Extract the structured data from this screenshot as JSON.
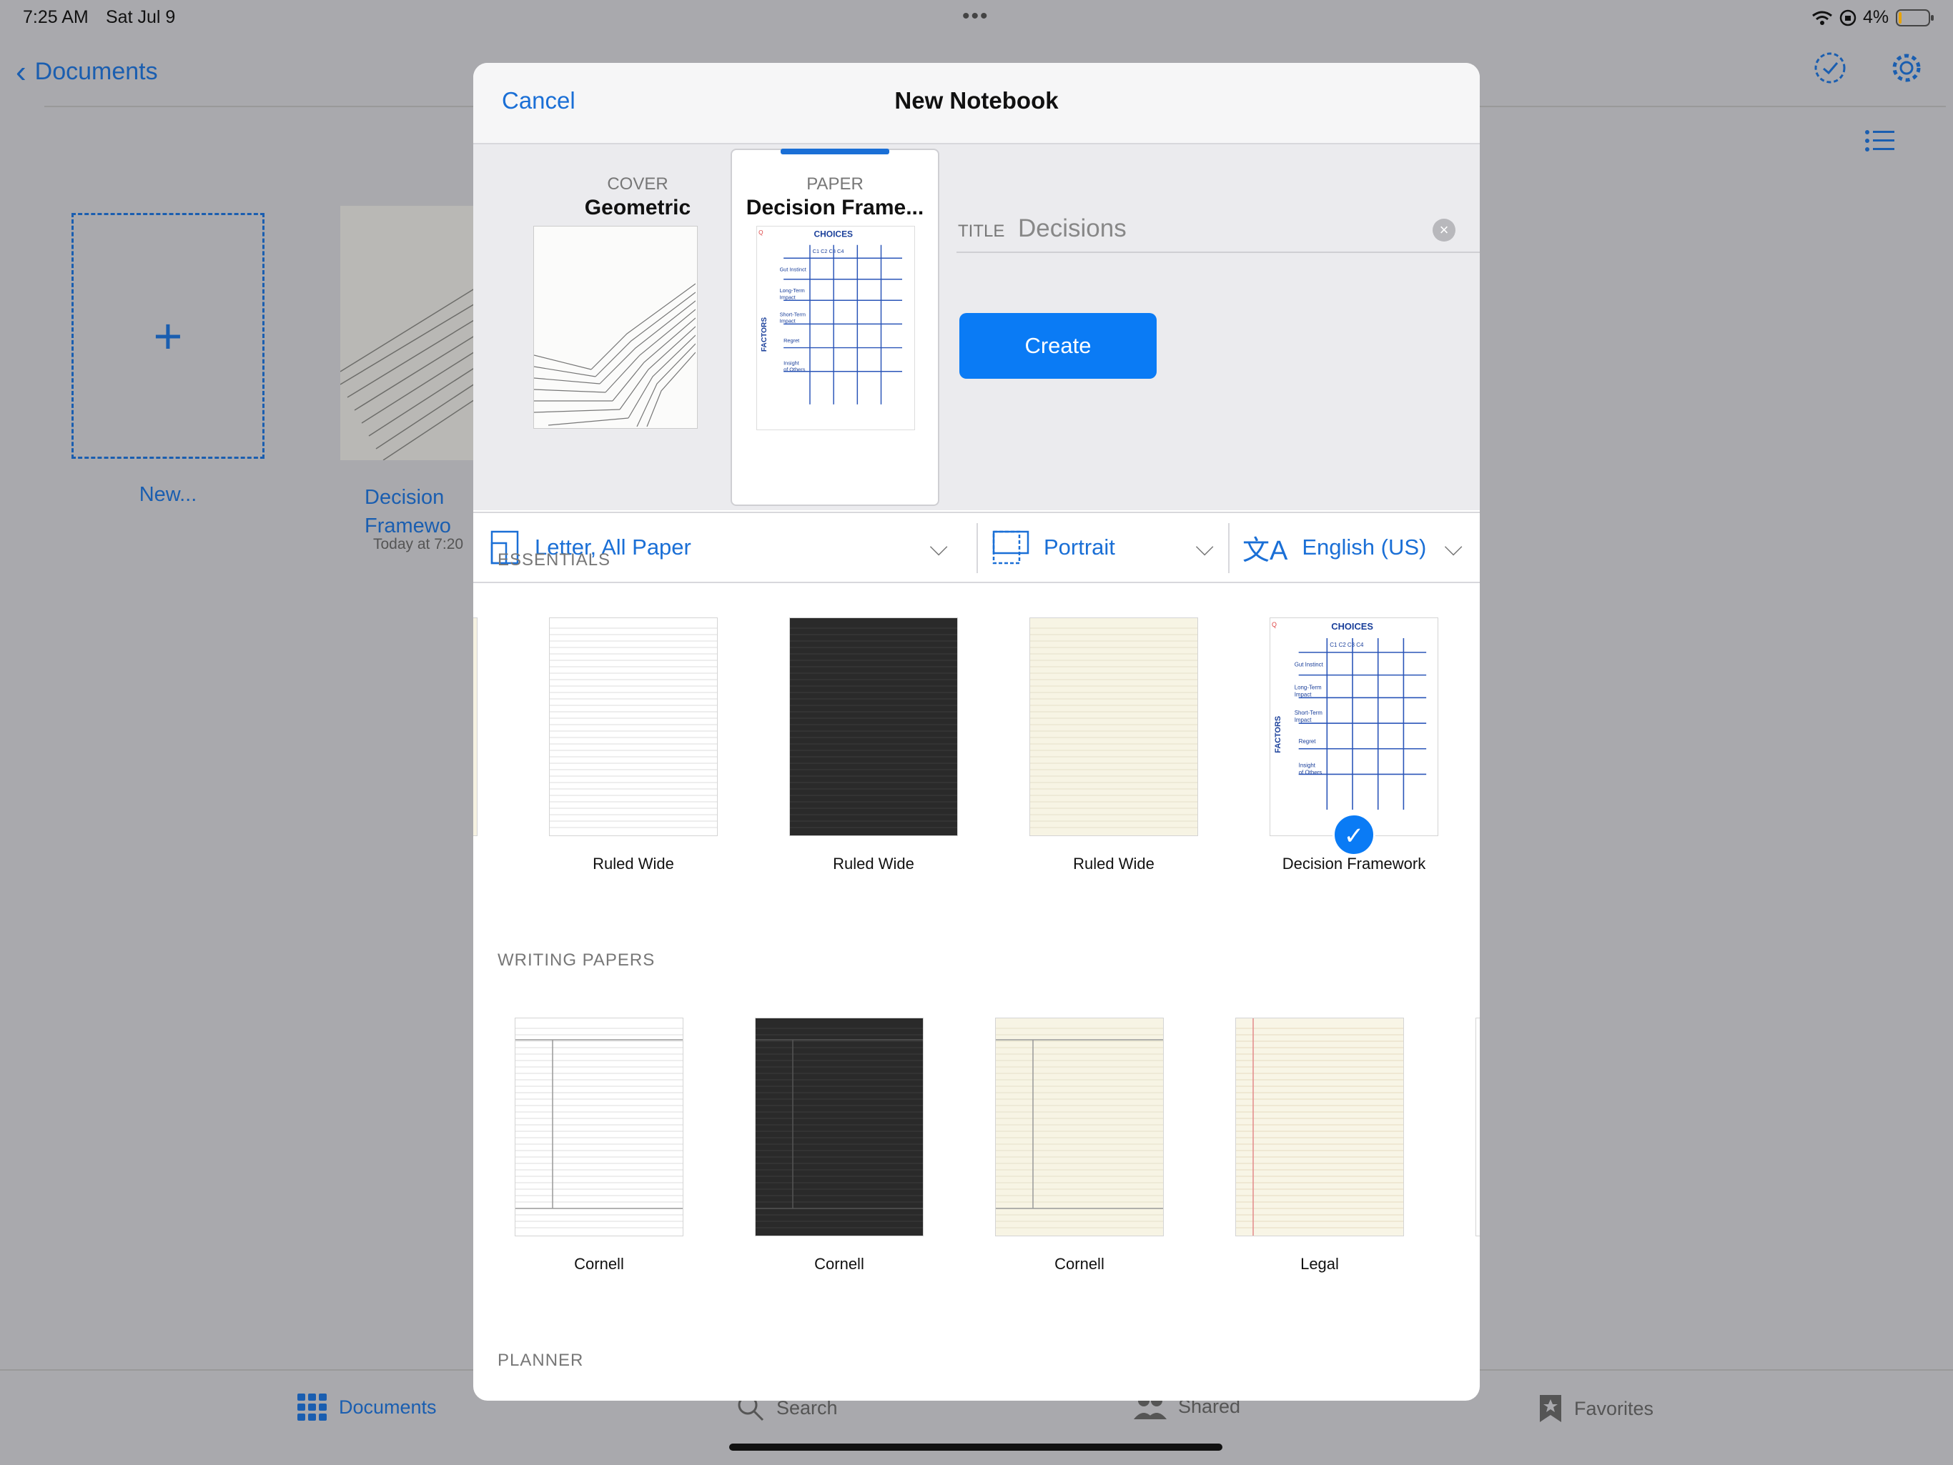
{
  "status_bar": {
    "time": "7:25 AM",
    "date": "Sat Jul 9",
    "dots": "•••",
    "battery": "4%"
  },
  "nav": {
    "back_label": "Documents"
  },
  "library": {
    "new_label": "New...",
    "doc_title_line1": "Decision",
    "doc_title_line2": "Framewo",
    "doc_date": "Today at 7:20"
  },
  "tabbar": {
    "documents": "Documents",
    "search": "Search",
    "shared": "Shared",
    "favorites": "Favorites"
  },
  "modal": {
    "cancel": "Cancel",
    "title": "New Notebook",
    "cover_label": "COVER",
    "cover_name": "Geometric",
    "paper_label": "PAPER",
    "paper_name": "Decision Frame...",
    "title_label": "TITLE",
    "title_value": "Decisions",
    "create": "Create",
    "options": {
      "size": "Letter, All Paper",
      "orientation": "Portrait",
      "language": "English (US)"
    },
    "sections": {
      "essentials": "ESSENTIALS",
      "writing": "WRITING PAPERS",
      "planner": "PLANNER"
    },
    "essentials": [
      {
        "name": "Ruled Wide",
        "style": "white"
      },
      {
        "name": "Ruled Wide",
        "style": "dark"
      },
      {
        "name": "Ruled Wide",
        "style": "yellow"
      },
      {
        "name": "Decision Framework",
        "style": "decision",
        "selected": true
      }
    ],
    "writing": [
      {
        "name": "Cornell",
        "style": "white"
      },
      {
        "name": "Cornell",
        "style": "dark"
      },
      {
        "name": "Cornell",
        "style": "yellow"
      },
      {
        "name": "Legal",
        "style": "legal"
      }
    ],
    "framework_text": {
      "choices": "CHOICES",
      "factors": "FACTORS",
      "cols": [
        "C1",
        "C2",
        "C3",
        "C4"
      ],
      "rows": [
        "Gut Instinct",
        "Long-Term Impact",
        "Short-Term Impact",
        "Regret",
        "Insight of Others"
      ]
    }
  },
  "colors": {
    "accent": "#1a6fd6",
    "create_bg": "#0a7bf5",
    "dim_bg": "#a9a9ad"
  }
}
